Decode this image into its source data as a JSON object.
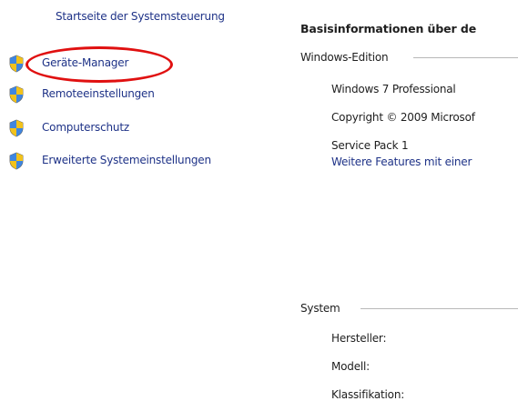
{
  "sidebar": {
    "home_link": "Startseite der Systemsteuerung",
    "items": [
      {
        "label": "Geräte-Manager",
        "icon": "uac-shield-icon"
      },
      {
        "label": "Remoteeinstellungen",
        "icon": "uac-shield-icon"
      },
      {
        "label": "Computerschutz",
        "icon": "uac-shield-icon"
      },
      {
        "label": "Erweiterte Systemeinstellungen",
        "icon": "uac-shield-icon"
      }
    ]
  },
  "main": {
    "title": "Basisinformationen über de",
    "edition": {
      "heading": "Windows-Edition",
      "name": "Windows 7 Professional",
      "copyright": "Copyright © 2009 Microsof",
      "service_pack": "Service Pack 1",
      "features_link": "Weitere Features mit einer"
    },
    "system": {
      "heading": "System",
      "manufacturer_label": "Hersteller:",
      "model_label": "Modell:",
      "rating_label": "Klassifikation:"
    }
  },
  "colors": {
    "link": "#1e3287",
    "highlight": "#e01010",
    "separator": "#b8b8b8"
  }
}
